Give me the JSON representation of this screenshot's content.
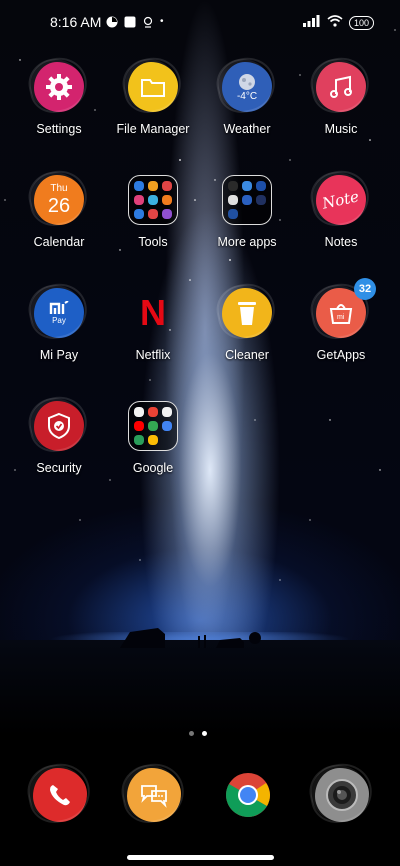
{
  "status_bar": {
    "time": "8:16 AM",
    "battery": "100"
  },
  "apps": [
    {
      "label": "Settings",
      "icon": "gear-icon",
      "color": "#d3246e"
    },
    {
      "label": "File Manager",
      "icon": "folder-icon",
      "color": "#f2c21b"
    },
    {
      "label": "Weather",
      "icon": "weather-icon",
      "color": "#2f5fb8",
      "temp": "-4°C"
    },
    {
      "label": "Music",
      "icon": "music-note-icon",
      "color": "#e0405e"
    },
    {
      "label": "Calendar",
      "icon": "calendar-icon",
      "color": "#f07c1e",
      "day": "Thu",
      "date": "26"
    },
    {
      "label": "Tools",
      "icon": "folder-grid-icon"
    },
    {
      "label": "More apps",
      "icon": "folder-grid-icon"
    },
    {
      "label": "Notes",
      "icon": "notes-icon",
      "color": "#e8345a",
      "text": "Note"
    },
    {
      "label": "Mi Pay",
      "icon": "mi-pay-icon",
      "color": "#1e5fc6",
      "text": "Pay"
    },
    {
      "label": "Netflix",
      "icon": "netflix-icon",
      "color": "#e50914",
      "text": "N"
    },
    {
      "label": "Cleaner",
      "icon": "trash-icon",
      "color": "#f2b51a"
    },
    {
      "label": "GetApps",
      "icon": "shopping-bag-icon",
      "color": "#ea5c48",
      "badge": "32"
    },
    {
      "label": "Security",
      "icon": "shield-icon",
      "color": "#c81e2a"
    },
    {
      "label": "Google",
      "icon": "folder-grid-icon"
    }
  ],
  "dock": [
    {
      "icon": "phone-icon",
      "color": "#dd2b2b"
    },
    {
      "icon": "messaging-icon",
      "color": "#f2a43a"
    },
    {
      "icon": "chrome-icon"
    },
    {
      "icon": "camera-icon",
      "color": "#8e8e8e"
    }
  ]
}
